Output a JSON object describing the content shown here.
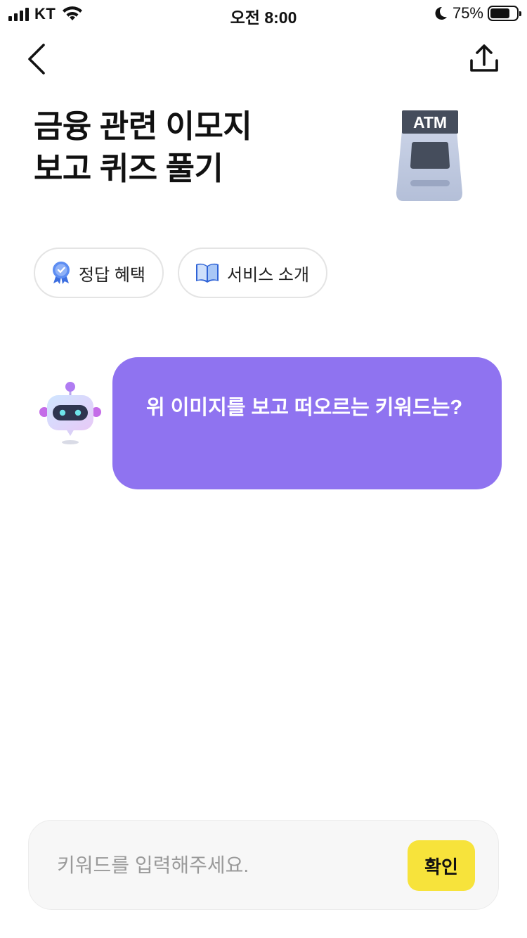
{
  "status_bar": {
    "carrier": "KT",
    "time": "오전 8:00",
    "battery_percent": "75%",
    "battery_level": 0.75
  },
  "nav": {
    "back_icon": "chevron-left-icon",
    "share_icon": "share-upload-icon"
  },
  "header": {
    "title_lines": [
      "금융 관련 이모지",
      "보고 퀴즈 풀기"
    ],
    "emoji": {
      "icon": "atm-icon",
      "label": "ATM"
    }
  },
  "chips": [
    {
      "label": "정답 혜택",
      "icon": "award-badge-icon"
    },
    {
      "label": "서비스 소개",
      "icon": "open-book-icon"
    }
  ],
  "bot_message": {
    "text": "위 이미지를 보고 떠오르는 키워드는?",
    "avatar_icon": "robot-icon"
  },
  "input": {
    "placeholder": "키워드를 입력해주세요.",
    "value": "",
    "submit_label": "확인"
  },
  "colors": {
    "bubble": "#8f73f0",
    "confirm_button": "#f7e33b",
    "input_background": "#f7f7f7"
  }
}
